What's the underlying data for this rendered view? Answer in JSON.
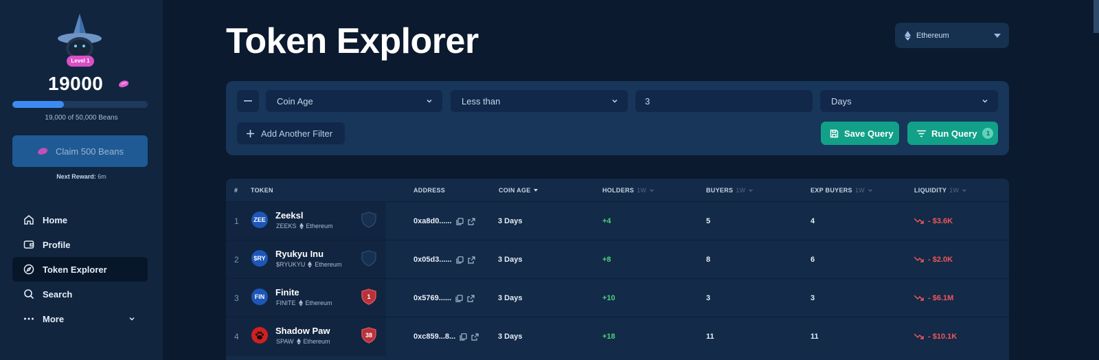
{
  "sidebar": {
    "level": "Level 1",
    "beans": "19000",
    "progress_text": "19,000 of 50,000 Beans",
    "progress_fraction": 0.38,
    "claim_label": "Claim 500 Beans",
    "next_reward_label": "Next Reward:",
    "next_reward_value": "6m",
    "nav": [
      {
        "label": "Home",
        "icon": "home-icon"
      },
      {
        "label": "Profile",
        "icon": "wallet-icon"
      },
      {
        "label": "Token Explorer",
        "icon": "compass-icon"
      },
      {
        "label": "Search",
        "icon": "search-icon"
      },
      {
        "label": "More",
        "icon": "more-dots-icon"
      }
    ]
  },
  "header": {
    "title": "Token Explorer",
    "network": "Ethereum"
  },
  "filters": {
    "field": "Coin Age",
    "operator": "Less than",
    "value": "3",
    "unit": "Days",
    "add_label": "Add Another Filter",
    "save_label": "Save Query",
    "run_label": "Run Query",
    "run_count": "1"
  },
  "table": {
    "columns": {
      "num": "#",
      "token": "TOKEN",
      "address": "ADDRESS",
      "coin_age": "COIN AGE",
      "holders": "HOLDERS",
      "buyers": "BUYERS",
      "exp_buyers": "EXP BUYERS",
      "liquidity": "LIQUIDITY",
      "period": "1W"
    },
    "rows": [
      {
        "num": "1",
        "logo": "ZEE",
        "name": "Zeeksl",
        "symbol": "ZEEKS",
        "chain": "Ethereum",
        "badge": "",
        "address": "0xa8d0......",
        "age": "3 Days",
        "holders": "+4",
        "buyers": "5",
        "exp_buyers": "4",
        "liquidity": "- $3.6K"
      },
      {
        "num": "2",
        "logo": "$RY",
        "name": "Ryukyu Inu",
        "symbol": "$RYUKYU",
        "chain": "Ethereum",
        "badge": "",
        "address": "0x05d3......",
        "age": "3 Days",
        "holders": "+8",
        "buyers": "8",
        "exp_buyers": "6",
        "liquidity": "- $2.0K"
      },
      {
        "num": "3",
        "logo": "FIN",
        "name": "Finite",
        "symbol": "FINITE",
        "chain": "Ethereum",
        "badge": "1",
        "address": "0x5769......",
        "age": "3 Days",
        "holders": "+10",
        "buyers": "3",
        "exp_buyers": "3",
        "liquidity": "- $6.1M"
      },
      {
        "num": "4",
        "logo": "",
        "name": "Shadow Paw",
        "symbol": "SPAW",
        "chain": "Ethereum",
        "badge": "38",
        "address": "0xc859...8...",
        "age": "3 Days",
        "holders": "+18",
        "buyers": "11",
        "exp_buyers": "11",
        "liquidity": "- $10.1K"
      }
    ]
  },
  "colors": {
    "accent_green": "#12a088",
    "positive": "#4ed17e",
    "negative": "#f0575a",
    "level_badge": "#d94fc7"
  }
}
